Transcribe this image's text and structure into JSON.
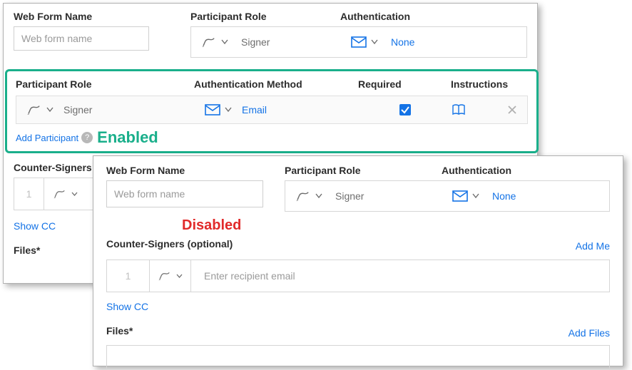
{
  "back": {
    "webFormLabel": "Web Form Name",
    "webFormPlaceholder": "Web form name",
    "roleLabel": "Participant Role",
    "roleValue": "Signer",
    "authLabel": "Authentication",
    "authValue": "None",
    "enabledBox": {
      "headers": {
        "role": "Participant Role",
        "method": "Authentication Method",
        "required": "Required",
        "instructions": "Instructions"
      },
      "roleValue": "Signer",
      "methodValue": "Email",
      "addParticipant": "Add Participant",
      "enabled": "Enabled"
    },
    "counterLabel": "Counter-Signers",
    "counterNum": "1",
    "showCC": "Show CC",
    "filesLabel": "Files*"
  },
  "front": {
    "webFormLabel": "Web Form Name",
    "webFormPlaceholder": "Web form name",
    "roleLabel": "Participant Role",
    "roleValue": "Signer",
    "authLabel": "Authentication",
    "authValue": "None",
    "disabled": "Disabled",
    "counterLabel": "Counter-Signers (optional)",
    "addMe": "Add Me",
    "counterNum": "1",
    "counterPlaceholder": "Enter recipient email",
    "showCC": "Show CC",
    "filesLabel": "Files*",
    "addFiles": "Add Files"
  }
}
